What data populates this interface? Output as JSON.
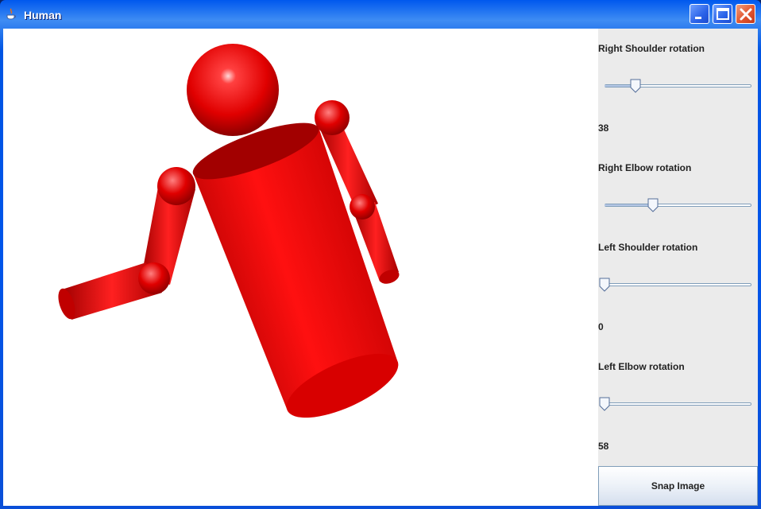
{
  "window": {
    "title": "Human",
    "app_icon": "java-cup-icon",
    "controls": [
      "minimize-icon",
      "maximize-icon",
      "close-icon"
    ]
  },
  "scene": {
    "figure_color": "#e60000",
    "background": "#ffffff"
  },
  "controls": {
    "right_shoulder": {
      "label": "Right Shoulder rotation",
      "value": "38",
      "fraction": 0.21
    },
    "right_elbow": {
      "label": "Right Elbow rotation",
      "value": "",
      "fraction": 0.33
    },
    "left_shoulder": {
      "label": "Left Shoulder rotation",
      "value": "0",
      "fraction": 0.0
    },
    "left_elbow": {
      "label": "Left Elbow rotation",
      "value": "58",
      "fraction": 0.0
    }
  },
  "snap_button": {
    "label": "Snap Image"
  }
}
